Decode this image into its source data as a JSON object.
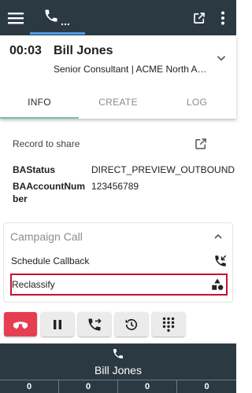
{
  "topbar": {
    "dots": "..."
  },
  "call": {
    "timer": "00:03",
    "name": "Bill Jones",
    "subtitle": "Senior Consultant | ACME North America"
  },
  "tabs": [
    {
      "label": "INFO",
      "active": true
    },
    {
      "label": "CREATE",
      "active": false
    },
    {
      "label": "LOG",
      "active": false
    }
  ],
  "info": {
    "record_to_share": "Record to share",
    "fields": [
      {
        "key": "BAStatus",
        "value": "DIRECT_PREVIEW_OUTBOUND"
      },
      {
        "key": "BAAccountNum",
        "key_line2": "ber",
        "value": "123456789"
      }
    ]
  },
  "campaign": {
    "title": "Campaign Call",
    "items": [
      {
        "label": "Schedule Callback",
        "icon": "phone-callback-icon"
      },
      {
        "label": "Reclassify",
        "icon": "shapes-icon",
        "highlighted": true
      }
    ]
  },
  "controls": [
    {
      "name": "end-call-button",
      "icon": "hangup-icon"
    },
    {
      "name": "hold-button",
      "icon": "pause-icon"
    },
    {
      "name": "transfer-button",
      "icon": "phone-forward-icon"
    },
    {
      "name": "history-button",
      "icon": "history-icon"
    },
    {
      "name": "dialpad-button",
      "icon": "dialpad-icon"
    }
  ],
  "status_bar": {
    "name": "Bill Jones",
    "counts": [
      "0",
      "0",
      "0",
      "0"
    ]
  },
  "colors": {
    "bar_bg": "#2b3a42",
    "accent_blue": "#4a9ee8",
    "tab_indicator": "#6fc2b2",
    "end_call": "#e53e51",
    "highlight_border": "#c8102e"
  }
}
